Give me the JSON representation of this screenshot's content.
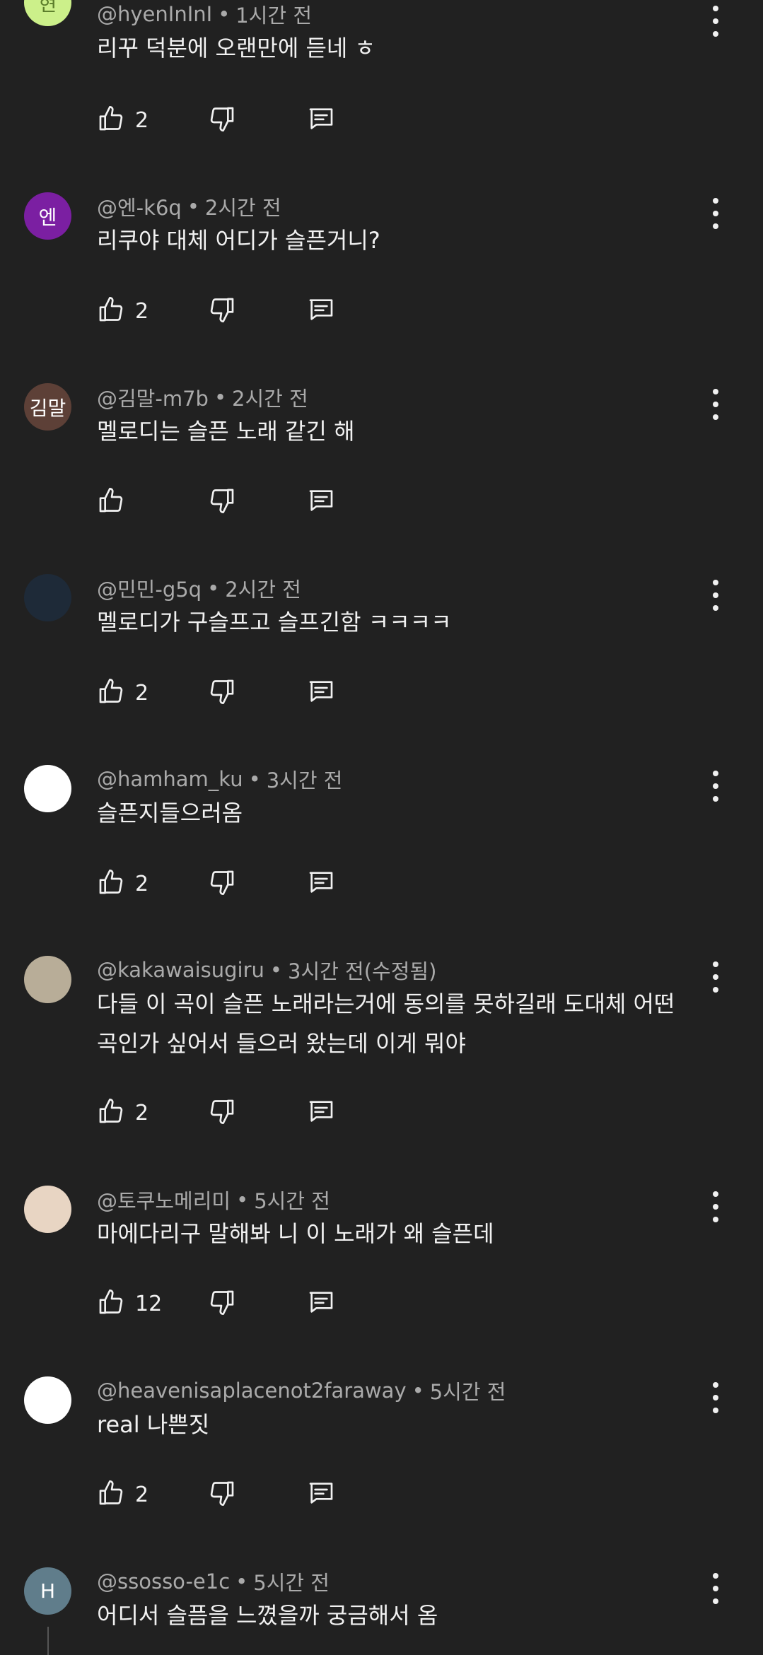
{
  "comments": [
    {
      "handle": "@hyenInInI",
      "time": "1시간 전",
      "text": "리꾸 덕분에 오랜만에 듣네 ㅎ",
      "likes": "2",
      "avatar": {
        "label": "현",
        "bg": "#ccf08a",
        "fg": "#5b7d2a"
      }
    },
    {
      "handle": "@엔-k6q",
      "time": "2시간 전",
      "text": "리쿠야 대체 어디가 슬픈거니?",
      "likes": "2",
      "avatar": {
        "label": "엔",
        "bg": "#7b1fa2",
        "fg": "#ffffff"
      }
    },
    {
      "handle": "@김말-m7b",
      "time": "2시간 전",
      "text": "멜로디는 슬픈 노래 같긴 해",
      "likes": "",
      "avatar": {
        "label": "김말",
        "bg": "#5d4037",
        "fg": "#ffffff"
      }
    },
    {
      "handle": "@민민-g5q",
      "time": "2시간 전",
      "text": "멜로디가 구슬프고 슬프긴함 ㅋㅋㅋㅋ",
      "likes": "2",
      "avatar": {
        "label": "",
        "bg": "#1e2a38",
        "fg": "#ffffff"
      }
    },
    {
      "handle": "@hamham_ku",
      "time": "3시간 전",
      "text": "슬픈지들으러옴",
      "likes": "2",
      "avatar": {
        "label": "",
        "bg": "#ffffff",
        "fg": "#ff8aa6"
      }
    },
    {
      "handle": "@kakawaisugiru",
      "time": "3시간 전(수정됨)",
      "text": "다들 이 곡이 슬픈 노래라는거에 동의를 못하길래 도대체 어떤곡인가 싶어서 들으러 왔는데 이게 뭐야",
      "likes": "2",
      "avatar": {
        "label": "",
        "bg": "#b8ad98",
        "fg": "#ffffff"
      }
    },
    {
      "handle": "@토쿠노메리미",
      "time": "5시간 전",
      "text": "마에다리구 말해봐 니 이 노래가 왜 슬픈데",
      "likes": "12",
      "avatar": {
        "label": "",
        "bg": "#e8d5c3",
        "fg": "#ffffff"
      }
    },
    {
      "handle": "@heavenisaplacenot2faraway",
      "time": "5시간 전",
      "text": "real 나쁜짓",
      "likes": "2",
      "avatar": {
        "label": "",
        "bg": "#ffffff",
        "fg": "#ffffff"
      }
    },
    {
      "handle": "@ssosso-e1c",
      "time": "5시간 전",
      "text": "어디서 슬픔을 느꼈을까 궁금해서 옴",
      "likes": "",
      "avatar": {
        "label": "H",
        "bg": "#607d8b",
        "fg": "#ffffff"
      }
    }
  ],
  "colors": {
    "background": "#212121",
    "meta": "#aaaaaa",
    "text": "#f1f1f1"
  },
  "icons": {
    "like": "thumbs-up-icon",
    "dislike": "thumbs-down-icon",
    "reply": "comment-icon",
    "more": "more-vert-icon"
  }
}
